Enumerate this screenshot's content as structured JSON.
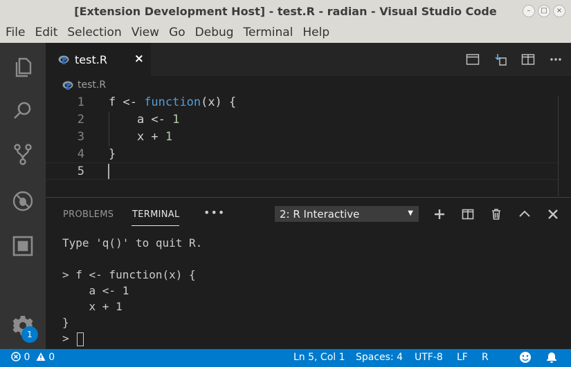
{
  "window": {
    "title": "[Extension Development Host] - test.R - radian - Visual Studio Code",
    "controls": {
      "minimize": "–",
      "maximize": "□",
      "close": "×"
    }
  },
  "menubar": {
    "items": [
      "File",
      "Edit",
      "Selection",
      "View",
      "Go",
      "Debug",
      "Terminal",
      "Help"
    ]
  },
  "activitybar": {
    "icons": [
      "explorer-icon",
      "search-icon",
      "source-control-icon",
      "debug-icon",
      "extensions-icon",
      "gear-icon"
    ],
    "settings_badge": "1"
  },
  "tabs": [
    {
      "label": "test.R",
      "icon": "r-language-icon",
      "close": "×"
    }
  ],
  "breadcrumb": {
    "label": "test.R"
  },
  "editor": {
    "lines": [
      {
        "n": "1"
      },
      {
        "n": "2"
      },
      {
        "n": "3"
      },
      {
        "n": "4"
      },
      {
        "n": "5"
      }
    ],
    "code": {
      "l1_a": "f <- ",
      "l1_kw": "function",
      "l1_b": "(x) {",
      "l2_a": "    a <- ",
      "l2_num": "1",
      "l3_a": "    x + ",
      "l3_num": "1",
      "l4": "}"
    }
  },
  "panel": {
    "tabs": {
      "problems": "PROBLEMS",
      "terminal": "TERMINAL"
    },
    "more": "•••",
    "terminal_select": "2: R Interactive",
    "terminal_lines": [
      "Type 'q()' to quit R.",
      "",
      "> f <- function(x) {",
      "    a <- 1",
      "    x + 1",
      "}",
      "> "
    ]
  },
  "statusbar": {
    "errors": "0",
    "warnings": "0",
    "position": "Ln 5, Col 1",
    "spaces": "Spaces: 4",
    "encoding": "UTF-8",
    "eol": "LF",
    "language": "R"
  },
  "colors": {
    "accent": "#007acc",
    "keyword": "#569cd6",
    "number": "#b5cea8"
  }
}
